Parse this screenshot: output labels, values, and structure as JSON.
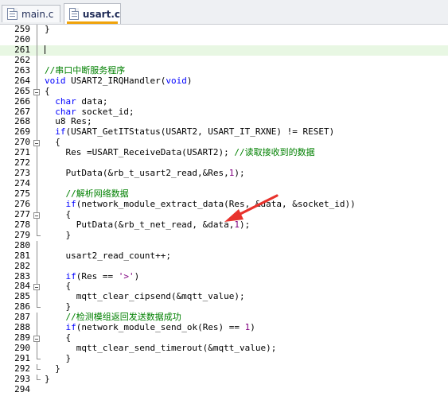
{
  "tabs": [
    {
      "label": "main.c",
      "active": false
    },
    {
      "label": "usart.c",
      "active": true
    }
  ],
  "colors": {
    "keyword": "#0000ff",
    "comment": "#008000",
    "number": "#800080",
    "current_line": "#e8f7e3",
    "annotation_arrow": "#e8322c"
  },
  "editor": {
    "lines": [
      {
        "n": "259",
        "fold": "line",
        "segs": [
          [
            "",
            "}"
          ]
        ]
      },
      {
        "n": "260",
        "fold": "line",
        "segs": []
      },
      {
        "n": "261",
        "fold": "line",
        "segs": [],
        "current": true
      },
      {
        "n": "262",
        "fold": "line",
        "segs": []
      },
      {
        "n": "263",
        "fold": "line",
        "segs": [
          [
            "cm",
            "//串口中断服务程序"
          ]
        ]
      },
      {
        "n": "264",
        "fold": "line",
        "segs": [
          [
            "kw",
            "void"
          ],
          [
            "",
            " USART2_IRQHandler("
          ],
          [
            "kw",
            "void"
          ],
          [
            "",
            ")"
          ]
        ]
      },
      {
        "n": "265",
        "fold": "box",
        "segs": [
          [
            "",
            "{"
          ]
        ]
      },
      {
        "n": "266",
        "fold": "line",
        "segs": [
          [
            "",
            "  "
          ],
          [
            "kw",
            "char"
          ],
          [
            "",
            " data;"
          ]
        ]
      },
      {
        "n": "267",
        "fold": "line",
        "segs": [
          [
            "",
            "  "
          ],
          [
            "kw",
            "char"
          ],
          [
            "",
            " socket_id;"
          ]
        ]
      },
      {
        "n": "268",
        "fold": "line",
        "segs": [
          [
            "",
            "  u8 Res;"
          ]
        ]
      },
      {
        "n": "269",
        "fold": "line",
        "segs": [
          [
            "",
            "  "
          ],
          [
            "kw",
            "if"
          ],
          [
            "",
            "(USART_GetITStatus(USART2, USART_IT_RXNE) != RESET)"
          ]
        ]
      },
      {
        "n": "270",
        "fold": "box",
        "segs": [
          [
            "",
            "  {"
          ]
        ]
      },
      {
        "n": "271",
        "fold": "line",
        "segs": [
          [
            "",
            "    Res =USART_ReceiveData(USART2); "
          ],
          [
            "cm",
            "//读取接收到的数据"
          ]
        ]
      },
      {
        "n": "272",
        "fold": "line",
        "segs": []
      },
      {
        "n": "273",
        "fold": "line",
        "segs": [
          [
            "",
            "    PutData(&rb_t_usart2_read,&Res,"
          ],
          [
            "num",
            "1"
          ],
          [
            "",
            ");"
          ]
        ]
      },
      {
        "n": "274",
        "fold": "line",
        "segs": []
      },
      {
        "n": "275",
        "fold": "line",
        "segs": [
          [
            "",
            "    "
          ],
          [
            "cm",
            "//解析网络数据"
          ]
        ]
      },
      {
        "n": "276",
        "fold": "line",
        "segs": [
          [
            "",
            "    "
          ],
          [
            "kw",
            "if"
          ],
          [
            "",
            "(network_module_extract_data(Res, &data, &socket_id))"
          ]
        ]
      },
      {
        "n": "277",
        "fold": "box",
        "segs": [
          [
            "",
            "    {"
          ]
        ]
      },
      {
        "n": "278",
        "fold": "line",
        "segs": [
          [
            "",
            "      PutData(&rb_t_net_read, &data,"
          ],
          [
            "num",
            "1"
          ],
          [
            "",
            ");"
          ]
        ]
      },
      {
        "n": "279",
        "fold": "end",
        "segs": [
          [
            "",
            "    }"
          ]
        ]
      },
      {
        "n": "280",
        "fold": "line",
        "segs": []
      },
      {
        "n": "281",
        "fold": "line",
        "segs": [
          [
            "",
            "    usart2_read_count++;"
          ]
        ]
      },
      {
        "n": "282",
        "fold": "line",
        "segs": []
      },
      {
        "n": "283",
        "fold": "line",
        "segs": [
          [
            "",
            "    "
          ],
          [
            "kw",
            "if"
          ],
          [
            "",
            "(Res == "
          ],
          [
            "str",
            "'>'"
          ],
          [
            "",
            ")"
          ]
        ]
      },
      {
        "n": "284",
        "fold": "box",
        "segs": [
          [
            "",
            "    {"
          ]
        ]
      },
      {
        "n": "285",
        "fold": "line",
        "segs": [
          [
            "",
            "      mqtt_clear_cipsend(&mqtt_value);"
          ]
        ]
      },
      {
        "n": "286",
        "fold": "end",
        "segs": [
          [
            "",
            "    }"
          ]
        ]
      },
      {
        "n": "287",
        "fold": "line",
        "segs": [
          [
            "",
            "    "
          ],
          [
            "cm",
            "//检测模组返回发送数据成功"
          ]
        ]
      },
      {
        "n": "288",
        "fold": "line",
        "segs": [
          [
            "",
            "    "
          ],
          [
            "kw",
            "if"
          ],
          [
            "",
            "(network_module_send_ok(Res) == "
          ],
          [
            "num",
            "1"
          ],
          [
            "",
            ")"
          ]
        ]
      },
      {
        "n": "289",
        "fold": "box",
        "segs": [
          [
            "",
            "    {"
          ]
        ]
      },
      {
        "n": "290",
        "fold": "line",
        "segs": [
          [
            "",
            "      mqtt_clear_send_timerout(&mqtt_value);"
          ]
        ]
      },
      {
        "n": "291",
        "fold": "end",
        "segs": [
          [
            "",
            "    }"
          ]
        ]
      },
      {
        "n": "292",
        "fold": "end",
        "segs": [
          [
            "",
            "  }"
          ]
        ]
      },
      {
        "n": "293",
        "fold": "end",
        "segs": [
          [
            "",
            "}"
          ]
        ]
      },
      {
        "n": "294",
        "fold": "none",
        "segs": []
      }
    ]
  }
}
